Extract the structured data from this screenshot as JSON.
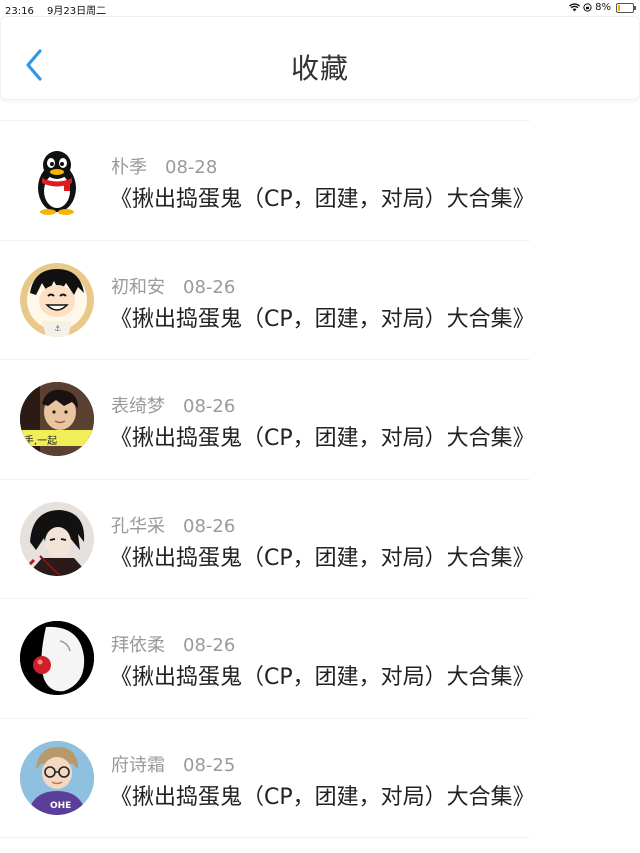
{
  "status_bar": {
    "time": "23:16",
    "date": "9月23日周二",
    "battery": "8%"
  },
  "nav": {
    "title": "收藏"
  },
  "favorites": [
    {
      "author": "朴季",
      "date": "08-28",
      "title": "《揪出捣蛋鬼（CP，团建，对局）大合集》",
      "avatar": "qq-penguin"
    },
    {
      "author": "初和安",
      "date": "08-26",
      "title": "《揪出捣蛋鬼（CP，团建，对局）大合集》",
      "avatar": "anime-boy-smile"
    },
    {
      "author": "表绮梦",
      "date": "08-26",
      "title": "《揪出捣蛋鬼（CP，团建，对局）大合集》",
      "avatar": "photo-boy",
      "avatar_text": "手,一起"
    },
    {
      "author": "孔华采",
      "date": "08-26",
      "title": "《揪出捣蛋鬼（CP，团建，对局）大合集》",
      "avatar": "anime-dark-hair"
    },
    {
      "author": "拜依柔",
      "date": "08-26",
      "title": "《揪出捣蛋鬼（CP，团建，对局）大合集》",
      "avatar": "clown-mask"
    },
    {
      "author": "府诗霜",
      "date": "08-25",
      "title": "《揪出捣蛋鬼（CP，团建，对局）大合集》",
      "avatar": "photo-glasses-boy",
      "avatar_text": "OHE"
    }
  ]
}
